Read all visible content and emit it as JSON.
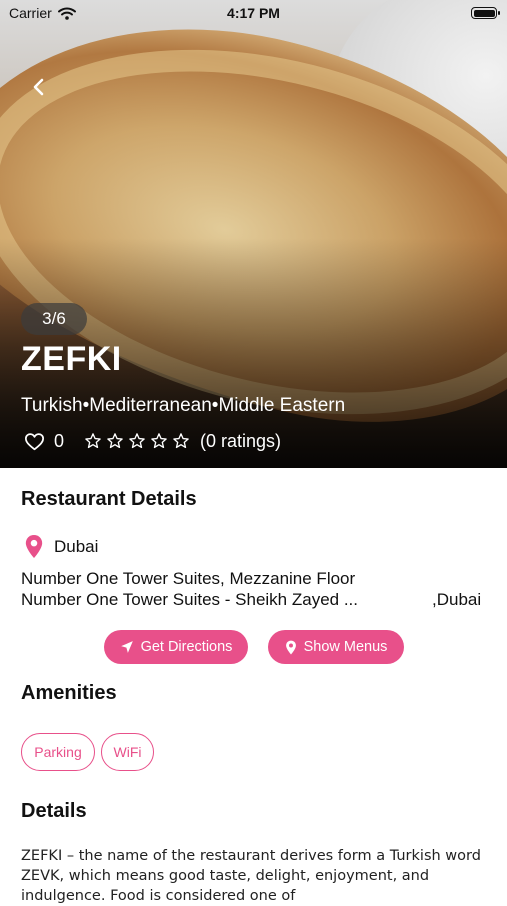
{
  "status_bar": {
    "carrier": "Carrier",
    "time": "4:17 PM"
  },
  "hero": {
    "image_counter": "3/6",
    "restaurant_name": "ZEFKI",
    "cuisines": [
      "Turkish",
      "Mediterranean",
      "Middle Eastern"
    ],
    "separator": "•",
    "likes_count": "0",
    "rating_stars": 0,
    "ratings_text": "(0 ratings)"
  },
  "restaurant_details": {
    "heading": "Restaurant Details",
    "city": "Dubai",
    "address_line_1": "Number One Tower Suites, Mezzanine Floor",
    "address_line_2": "Number One Tower Suites - Sheikh Zayed ...",
    "address_city_suffix": ",Dubai",
    "get_directions_label": "Get Directions",
    "show_menus_label": "Show Menus"
  },
  "amenities": {
    "heading": "Amenities",
    "items": [
      "Parking",
      "WiFi"
    ]
  },
  "details": {
    "heading": "Details",
    "text": "ZEFKI – the name of the restaurant derives form a Turkish word ZEVK, which means good taste, delight, enjoyment, and indulgence. Food is considered one of"
  },
  "colors": {
    "accent": "#e8508a",
    "text": "#111111",
    "white": "#ffffff"
  },
  "icons": {
    "back": "chevron-left-icon",
    "heart": "heart-outline-icon",
    "star": "star-outline-icon",
    "location": "map-pin-icon",
    "directions": "navigation-arrow-icon",
    "menus": "map-pin-icon"
  }
}
